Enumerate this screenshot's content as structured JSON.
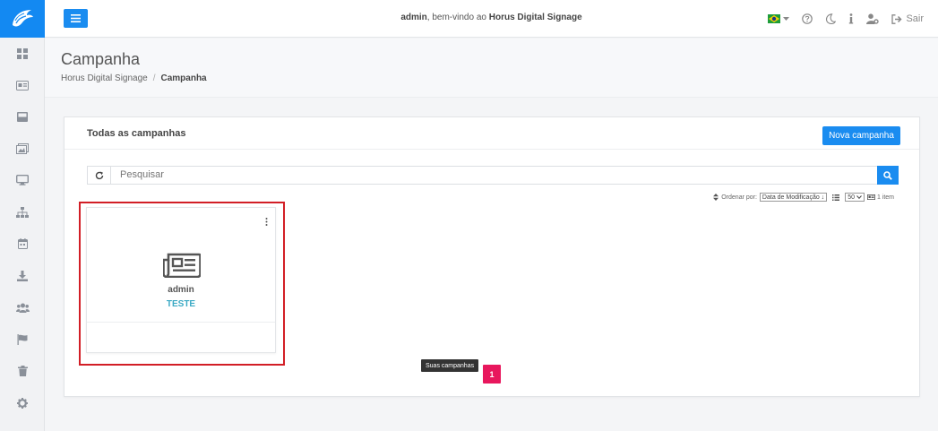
{
  "header": {
    "welcome_user": "admin",
    "welcome_text": ", bem-vindo ao ",
    "app_name": "Horus Digital Signage",
    "logout_label": "Sair"
  },
  "sidebar": {
    "items": [
      {
        "icon": "dashboard-icon"
      },
      {
        "icon": "media-icon"
      },
      {
        "icon": "layout-icon"
      },
      {
        "icon": "gallery-icon"
      },
      {
        "icon": "monitor-icon"
      },
      {
        "icon": "sitemap-icon"
      },
      {
        "icon": "calendar-icon"
      },
      {
        "icon": "download-icon"
      },
      {
        "icon": "users-icon"
      },
      {
        "icon": "flag-icon"
      },
      {
        "icon": "trash-icon"
      },
      {
        "icon": "settings-icon"
      }
    ]
  },
  "page": {
    "title": "Campanha",
    "breadcrumb": [
      "Horus Digital Signage",
      "Campanha"
    ],
    "breadcrumb_sep": "/"
  },
  "card": {
    "title": "Todas as campanhas",
    "new_button": "Nova campanha",
    "search_placeholder": "Pesquisar",
    "sort_label": "Ordenar por:",
    "sort_value": "Data de Modificação ↓",
    "page_size": "50",
    "item_count": "1 item"
  },
  "campaigns": [
    {
      "owner": "admin",
      "name": "TESTE"
    }
  ],
  "pagination": {
    "tooltip": "Suas campanhas",
    "current_page": "1"
  },
  "colors": {
    "primary": "#1a8cf0",
    "accent_pink": "#e8175d",
    "highlight_red": "#d21e26",
    "teal_text": "#3aa9c4"
  }
}
